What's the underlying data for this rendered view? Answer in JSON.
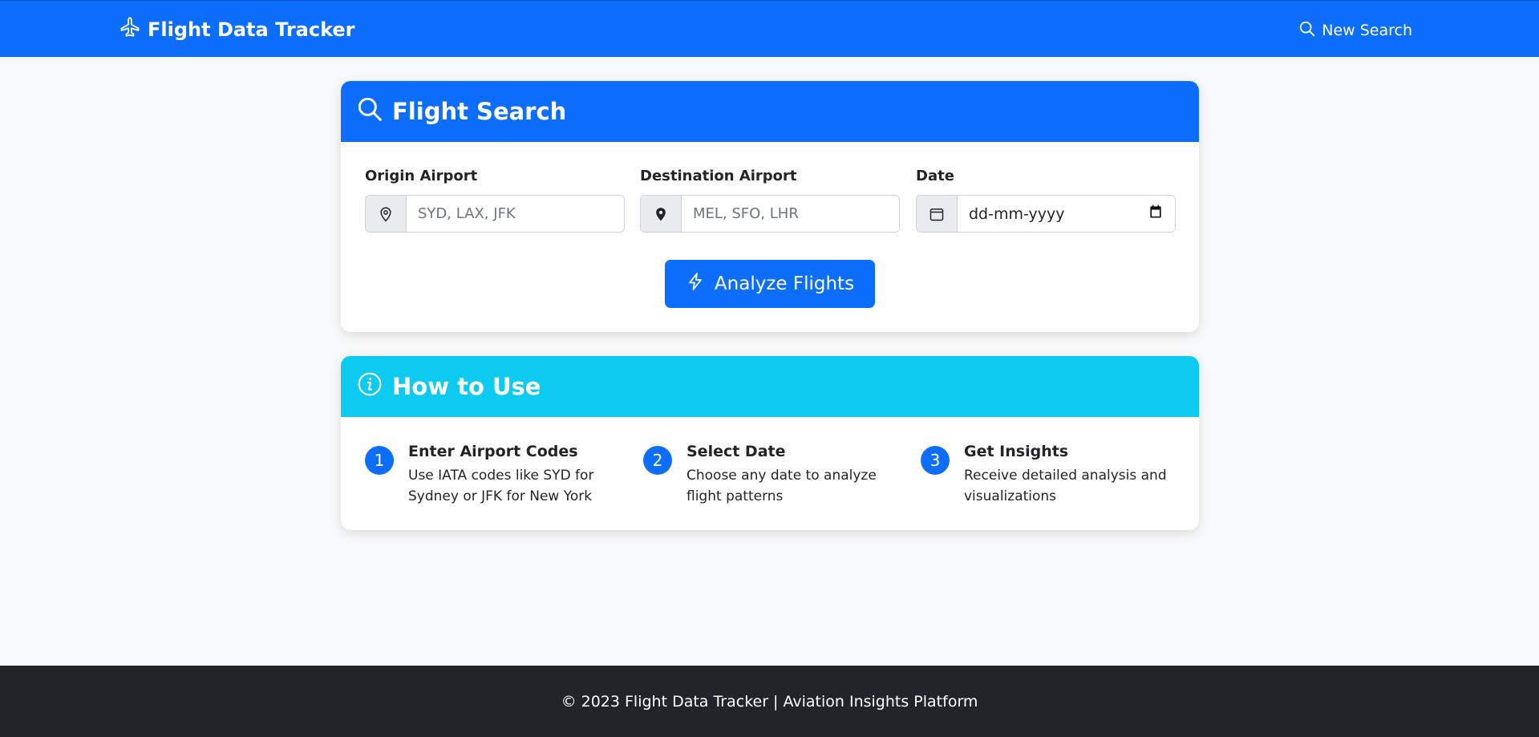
{
  "navbar": {
    "brand": "Flight Data Tracker",
    "new_search": "New Search"
  },
  "search_card": {
    "title": "Flight Search",
    "origin": {
      "label": "Origin Airport",
      "placeholder": "SYD, LAX, JFK",
      "value": ""
    },
    "destination": {
      "label": "Destination Airport",
      "placeholder": "MEL, SFO, LHR",
      "value": ""
    },
    "date": {
      "label": "Date",
      "placeholder": "dd-mm-yyyy"
    },
    "button": "Analyze Flights"
  },
  "howto_card": {
    "title": "How to Use",
    "steps": [
      {
        "num": "1",
        "title": "Enter Airport Codes",
        "desc": "Use IATA codes like SYD for Sydney or JFK for New York"
      },
      {
        "num": "2",
        "title": "Select Date",
        "desc": "Choose any date to analyze flight patterns"
      },
      {
        "num": "3",
        "title": "Get Insights",
        "desc": "Receive detailed analysis and visualizations"
      }
    ]
  },
  "footer": {
    "text": "© 2023 Flight Data Tracker | Aviation Insights Platform"
  },
  "icons": {
    "brand": "airplane-icon",
    "new_search": "search-icon",
    "search_header": "search-icon",
    "origin": "geo-alt-outline-icon",
    "destination": "geo-alt-fill-icon",
    "date": "calendar-icon",
    "button": "lightning-icon",
    "howto_header": "info-circle-icon"
  },
  "colors": {
    "primary": "#0d6efd",
    "info": "#0dcaf0",
    "dark": "#212529",
    "background": "#f8f9fa"
  }
}
